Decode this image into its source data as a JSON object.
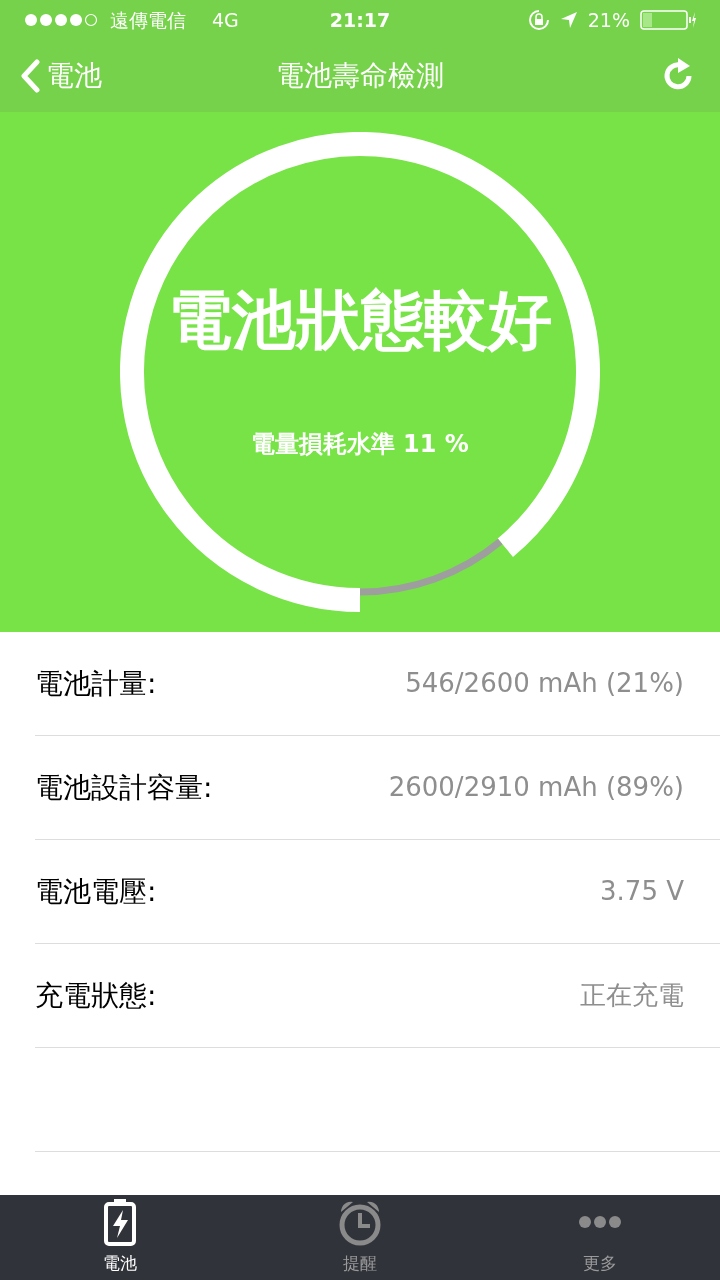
{
  "status_bar": {
    "carrier": "遠傳電信",
    "network": "4G",
    "time": "21:17",
    "battery_percent": "21%"
  },
  "nav": {
    "back": "電池",
    "title": "電池壽命檢測"
  },
  "gauge": {
    "status": "電池狀態較好",
    "wear_label": "電量損耗水準",
    "wear_value": "11 %"
  },
  "rows": [
    {
      "label": "電池計量:",
      "value": "546/2600 mAh (21%)"
    },
    {
      "label": "電池設計容量:",
      "value": "2600/2910 mAh (89%)"
    },
    {
      "label": "電池電壓:",
      "value": "3.75 V"
    },
    {
      "label": "充電狀態:",
      "value": "正在充電"
    }
  ],
  "tabs": [
    {
      "kind": "battery",
      "label": "電池",
      "selected": true
    },
    {
      "kind": "alarm",
      "label": "提醒",
      "selected": false
    },
    {
      "kind": "more",
      "label": "更多",
      "selected": false
    }
  ]
}
